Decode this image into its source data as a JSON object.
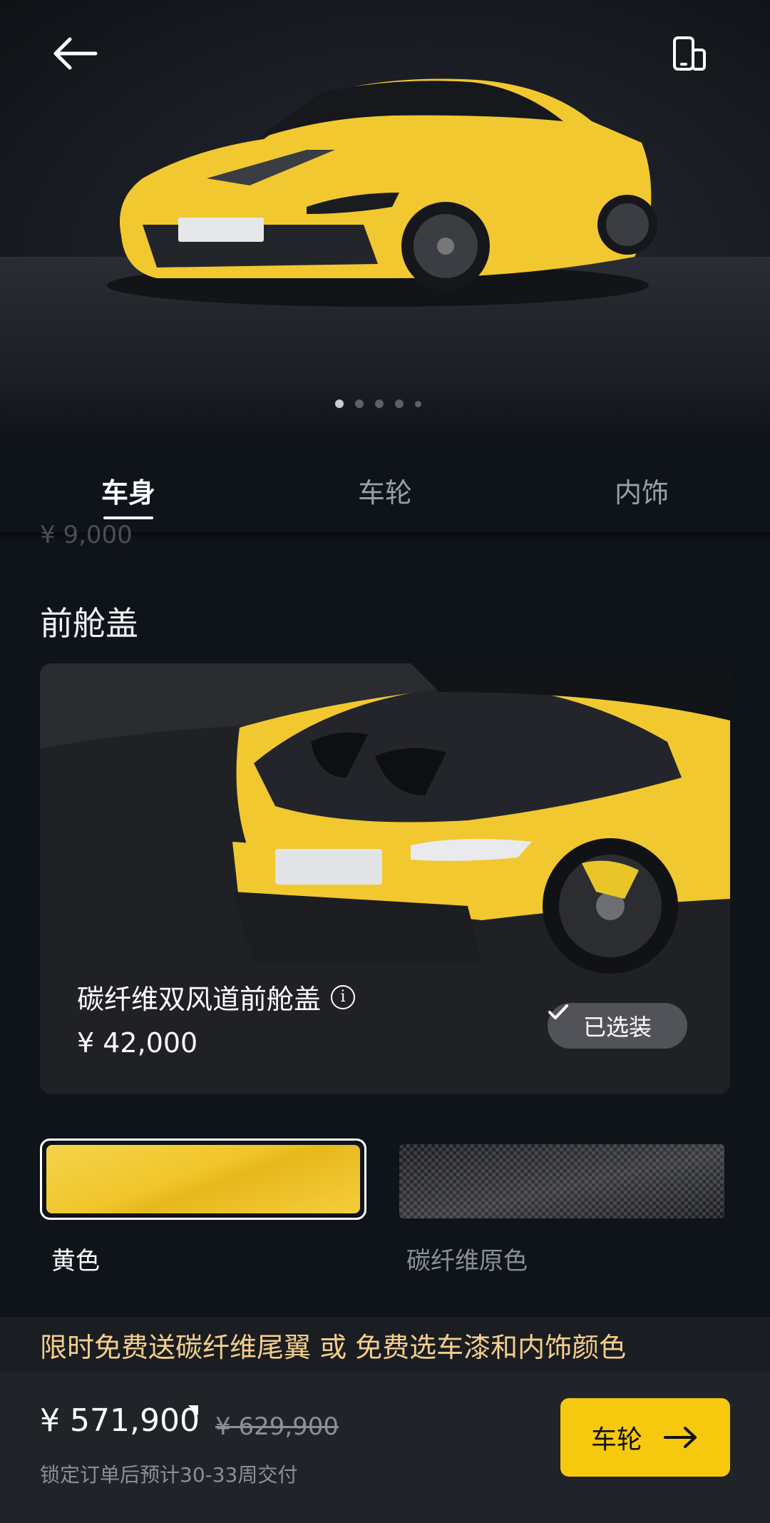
{
  "tabs": [
    {
      "label": "车身",
      "active": true
    },
    {
      "label": "车轮",
      "active": false
    },
    {
      "label": "内饰",
      "active": false
    }
  ],
  "carousel": {
    "pages": 5,
    "current": 1
  },
  "previous_section_price_partial": "¥ 9,000",
  "section": {
    "title": "前舱盖",
    "option": {
      "name": "碳纤维双风道前舱盖",
      "price": "¥ 42,000",
      "status": "已选装"
    },
    "colors": [
      {
        "label": "黄色",
        "selected": true
      },
      {
        "label": "碳纤维原色",
        "selected": false
      }
    ]
  },
  "promo": "限时免费送碳纤维尾翼 或 免费选车漆和内饰颜色",
  "bottom": {
    "price": "¥ 571,900",
    "original_price": "¥ 629,900",
    "delivery": "锁定订单后预计30-33周交付",
    "next_label": "车轮"
  },
  "icons": {
    "back": "arrow-left-icon",
    "device": "phone-device-icon",
    "info": "info-icon",
    "check": "check-icon",
    "next": "arrow-right-icon"
  },
  "colors": {
    "accent": "#f6c90e",
    "body_yellow": "#f2c830",
    "promo_text": "#f4cf8a"
  }
}
